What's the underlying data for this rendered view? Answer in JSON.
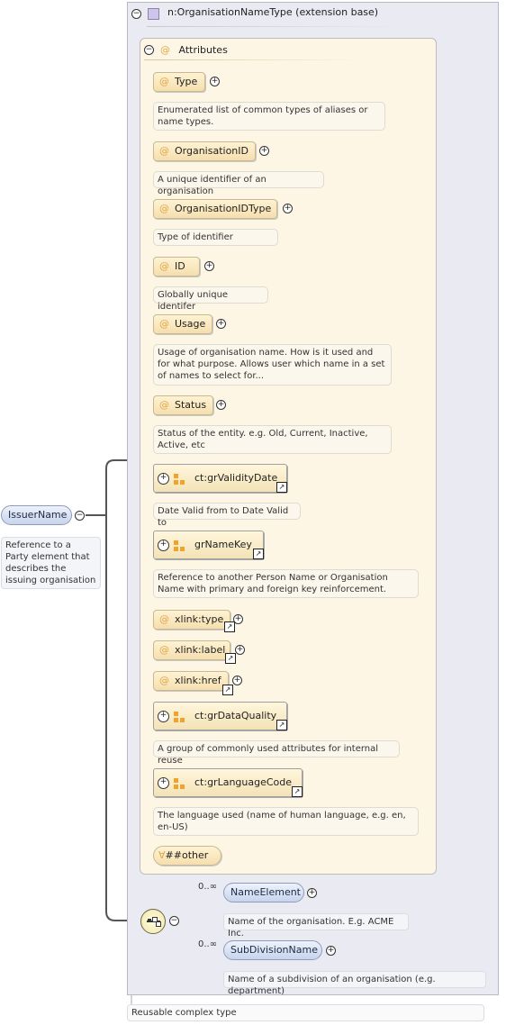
{
  "extension": {
    "title": "n:OrganisationNameType (extension base)"
  },
  "attributes_header": "Attributes",
  "attributes": [
    {
      "name": "Type",
      "doc": "Enumerated list of common types of aliases or name types."
    },
    {
      "name": "OrganisationID",
      "doc": "A unique identifier of an organisation"
    },
    {
      "name": "OrganisationIDType",
      "doc": "Type of identifier"
    },
    {
      "name": "ID",
      "doc": "Globally unique identifer"
    },
    {
      "name": "Usage",
      "doc": "Usage of organisation name. How is it used and for what purpose. Allows user which name in a set of names to select for..."
    },
    {
      "name": "Status",
      "doc": "Status of the entity. e.g. Old, Current, Inactive, Active, etc"
    }
  ],
  "groups": [
    {
      "name": "ct:grValidityDate",
      "doc": "Date Valid from to Date Valid to"
    },
    {
      "name": "grNameKey",
      "doc": "Reference to another Person Name or Organisation Name with primary and foreign key reinforcement."
    },
    {
      "name": "ct:grDataQuality",
      "doc": "A group of commonly used attributes for internal reuse"
    },
    {
      "name": "ct:grLanguageCode",
      "doc": "The language used (name of human language, e.g. en, en-US)"
    }
  ],
  "xlink_attributes": [
    "xlink:type",
    "xlink:label",
    "xlink:href"
  ],
  "any_attribute": "##other",
  "root_element": {
    "name": "IssuerName",
    "doc": "Reference to a Party element that describes the issuing organisation"
  },
  "sequence_children": [
    {
      "name": "NameElement",
      "cardinality": "0..∞",
      "doc": "Name of the organisation. E.g. ACME Inc."
    },
    {
      "name": "SubDivisionName",
      "cardinality": "0..∞",
      "doc": "Name of a subdivision of an organisation (e.g. department)"
    }
  ],
  "footer": "Reusable complex type",
  "icons": {
    "collapse": "minus-circle-icon",
    "expand": "plus-circle-icon",
    "attribute": "at-sign-icon",
    "group": "attribute-group-icon",
    "reference": "reference-arrow-icon",
    "sequence": "sequence-compositor-icon"
  },
  "colors": {
    "attr_panel": "#fdf6e4",
    "outer_box": "#eaeaf2",
    "element_pill": "#c8d4ec",
    "attr_pill": "#f5deae"
  }
}
